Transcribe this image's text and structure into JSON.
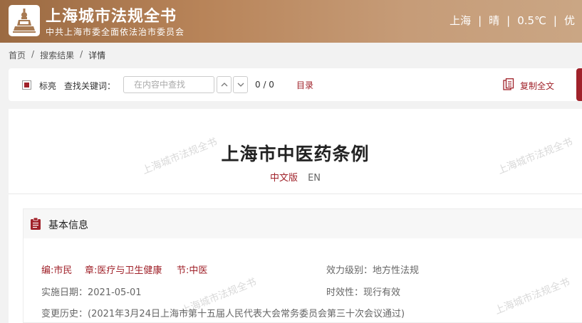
{
  "header": {
    "title": "上海城市法规全书",
    "subtitle": "中共上海市委全面依法治市委员会",
    "weather": {
      "city": "上海",
      "condition": "晴",
      "temperature": "0.5℃",
      "aqi": "优"
    }
  },
  "breadcrumb": {
    "home": "首页",
    "results": "搜索结果",
    "current": "详情",
    "separator": "/"
  },
  "toolbar": {
    "mark_label": "标亮",
    "find_label": "查找关键词：",
    "search_placeholder": "在内容中查找",
    "match_count": "0 / 0",
    "toc_label": "目录",
    "copy_label": "复制全文"
  },
  "document": {
    "title": "上海市中医药条例",
    "lang_cn": "中文版",
    "lang_en": "EN"
  },
  "basic_info": {
    "heading": "基本信息",
    "category_chapter": "编:市民",
    "category_section": "章:医疗与卫生健康",
    "category_node": "节:中医",
    "effect_level": "效力级别：地方性法规",
    "effective_date": "实施日期：2021-05-01",
    "validity": "时效性：现行有效",
    "history": "变更历史：(2021年3月24日上海市第十五届人民代表大会常务委员会第三十次会议通过)"
  },
  "watermark": "上海城市法规全书",
  "colors": {
    "brand_red": "#a0222a",
    "header_brown": "#b88459"
  }
}
